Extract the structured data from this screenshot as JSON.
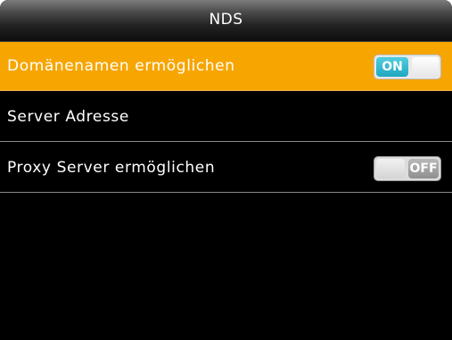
{
  "header": {
    "title": "NDS"
  },
  "settings": [
    {
      "label": "Domänenamen ermöglichen",
      "toggle": "ON",
      "enabled": true,
      "selected": true
    },
    {
      "label": "Server Adresse"
    },
    {
      "label": "Proxy Server ermöglichen",
      "toggle": "OFF",
      "enabled": false
    }
  ],
  "colors": {
    "selected_row": "#f7a500",
    "toggle_on": "#29b3cb",
    "toggle_off": "#9f9f9f",
    "background": "#000000"
  }
}
